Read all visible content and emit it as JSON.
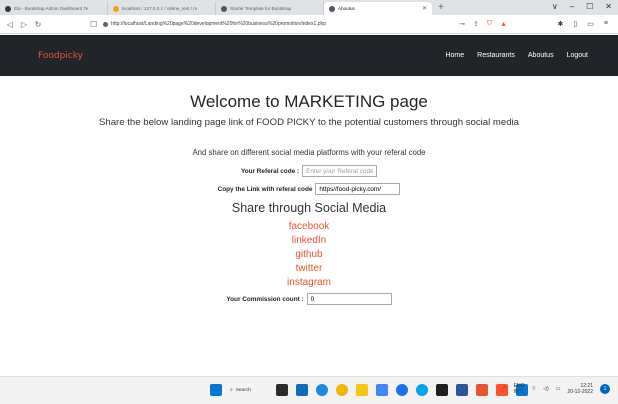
{
  "browser": {
    "tabs": [
      {
        "title": "Ela - Bootstrap Admin Dashboard Te",
        "favicon_color": "#333333",
        "active": false
      },
      {
        "title": "localhost / 127.0.0.1 / online_rest / m",
        "favicon_color": "#f0a30a",
        "active": false
      },
      {
        "title": "Starter Template for Bootstrap",
        "favicon_color": "#555555",
        "active": false
      },
      {
        "title": "Aboutus",
        "favicon_color": "#555555",
        "active": true
      }
    ],
    "new_tab": "+",
    "window_controls": [
      "∨",
      "–",
      "☐",
      "✕"
    ],
    "url": "http://localhost/Landing%20page%20development%20for%20business%20promotion/index1.php"
  },
  "navbar": {
    "brand": "Foodpicky",
    "links": [
      "Home",
      "Restaurants",
      "Aboutus",
      "Logout"
    ]
  },
  "main": {
    "title": "Welcome to MARKETING page",
    "subtitle": "Share the below landing page link of FOOD PICKY to the potential customers through social media",
    "share_different": "And share on different social media platforms with your referal code",
    "referal_label": "Your Referal code :",
    "referal_placeholder": "Enter your Referal code",
    "copy_label": "Copy the Link with referal code",
    "copy_value": "https//food-picky.com/",
    "share_title": "Share through Social Media",
    "social_links": [
      "facebook",
      "linkedIn",
      "github",
      "twitter",
      "instagram"
    ],
    "commission_label": "Your Commission count :",
    "commission_value": "0"
  },
  "taskbar": {
    "search_label": "Search",
    "lang_top": "ENG",
    "lang_bottom": "INTL",
    "time": "12:21",
    "date": "20-12-2022",
    "notification_count": "1"
  },
  "colors": {
    "accent": "#e8542f",
    "navbar_bg": "#212529"
  }
}
